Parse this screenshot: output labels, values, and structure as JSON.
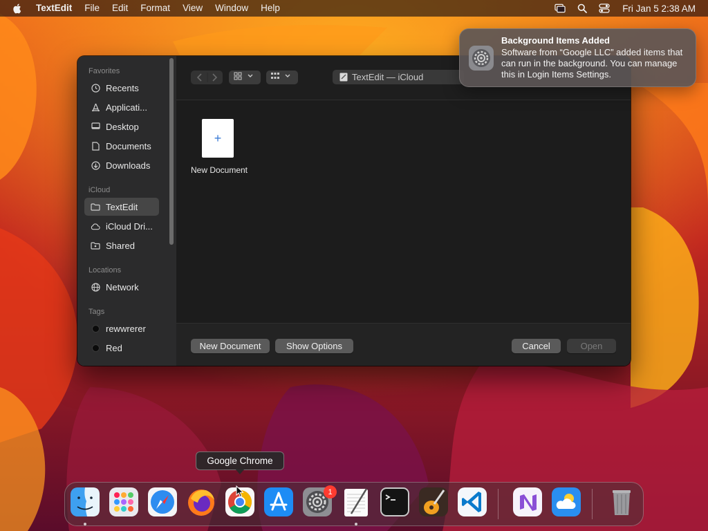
{
  "menubar": {
    "app_name": "TextEdit",
    "menus": [
      "File",
      "Edit",
      "Format",
      "View",
      "Window",
      "Help"
    ],
    "clock": "Fri Jan 5  2:38 AM",
    "status_icons": [
      "screen-mirroring-icon",
      "search-icon",
      "control-center-icon"
    ]
  },
  "dialog": {
    "sidebar": {
      "sections": {
        "favorites": "Favorites",
        "icloud": "iCloud",
        "locations": "Locations",
        "tags": "Tags"
      },
      "favorites": [
        {
          "label": "Recents",
          "icon": "clock-icon"
        },
        {
          "label": "Applicati...",
          "icon": "applications-icon"
        },
        {
          "label": "Desktop",
          "icon": "desktop-icon"
        },
        {
          "label": "Documents",
          "icon": "document-icon"
        },
        {
          "label": "Downloads",
          "icon": "download-icon"
        }
      ],
      "icloud": [
        {
          "label": "TextEdit",
          "icon": "folder-icon",
          "selected": true
        },
        {
          "label": "iCloud Dri...",
          "icon": "cloud-icon"
        },
        {
          "label": "Shared",
          "icon": "shared-folder-icon"
        }
      ],
      "locations": [
        {
          "label": "Network",
          "icon": "network-icon"
        }
      ],
      "tags": [
        {
          "label": "rewwrerer",
          "color": "#0b0b0b"
        },
        {
          "label": "Red",
          "color": "#0b0b0b"
        }
      ]
    },
    "path_popup": "TextEdit — iCloud",
    "files": [
      {
        "label": "New Document",
        "icon_glyph": "+"
      }
    ],
    "buttons": {
      "new_document": "New Document",
      "show_options": "Show Options",
      "cancel": "Cancel",
      "open": "Open"
    }
  },
  "notification": {
    "title": "Background Items Added",
    "body": "Software from “Google LLC” added items that can run in the background. You can manage this in Login Items Settings."
  },
  "dock": {
    "tooltip": "Google Chrome",
    "badge_count": "1",
    "apps": [
      "Finder",
      "Launchpad",
      "Safari",
      "Firefox",
      "Google Chrome",
      "App Store",
      "System Settings",
      "TextEdit",
      "Terminal",
      "GarageBand",
      "Visual Studio Code",
      "Visual Studio",
      "Weather",
      "Trash"
    ]
  }
}
